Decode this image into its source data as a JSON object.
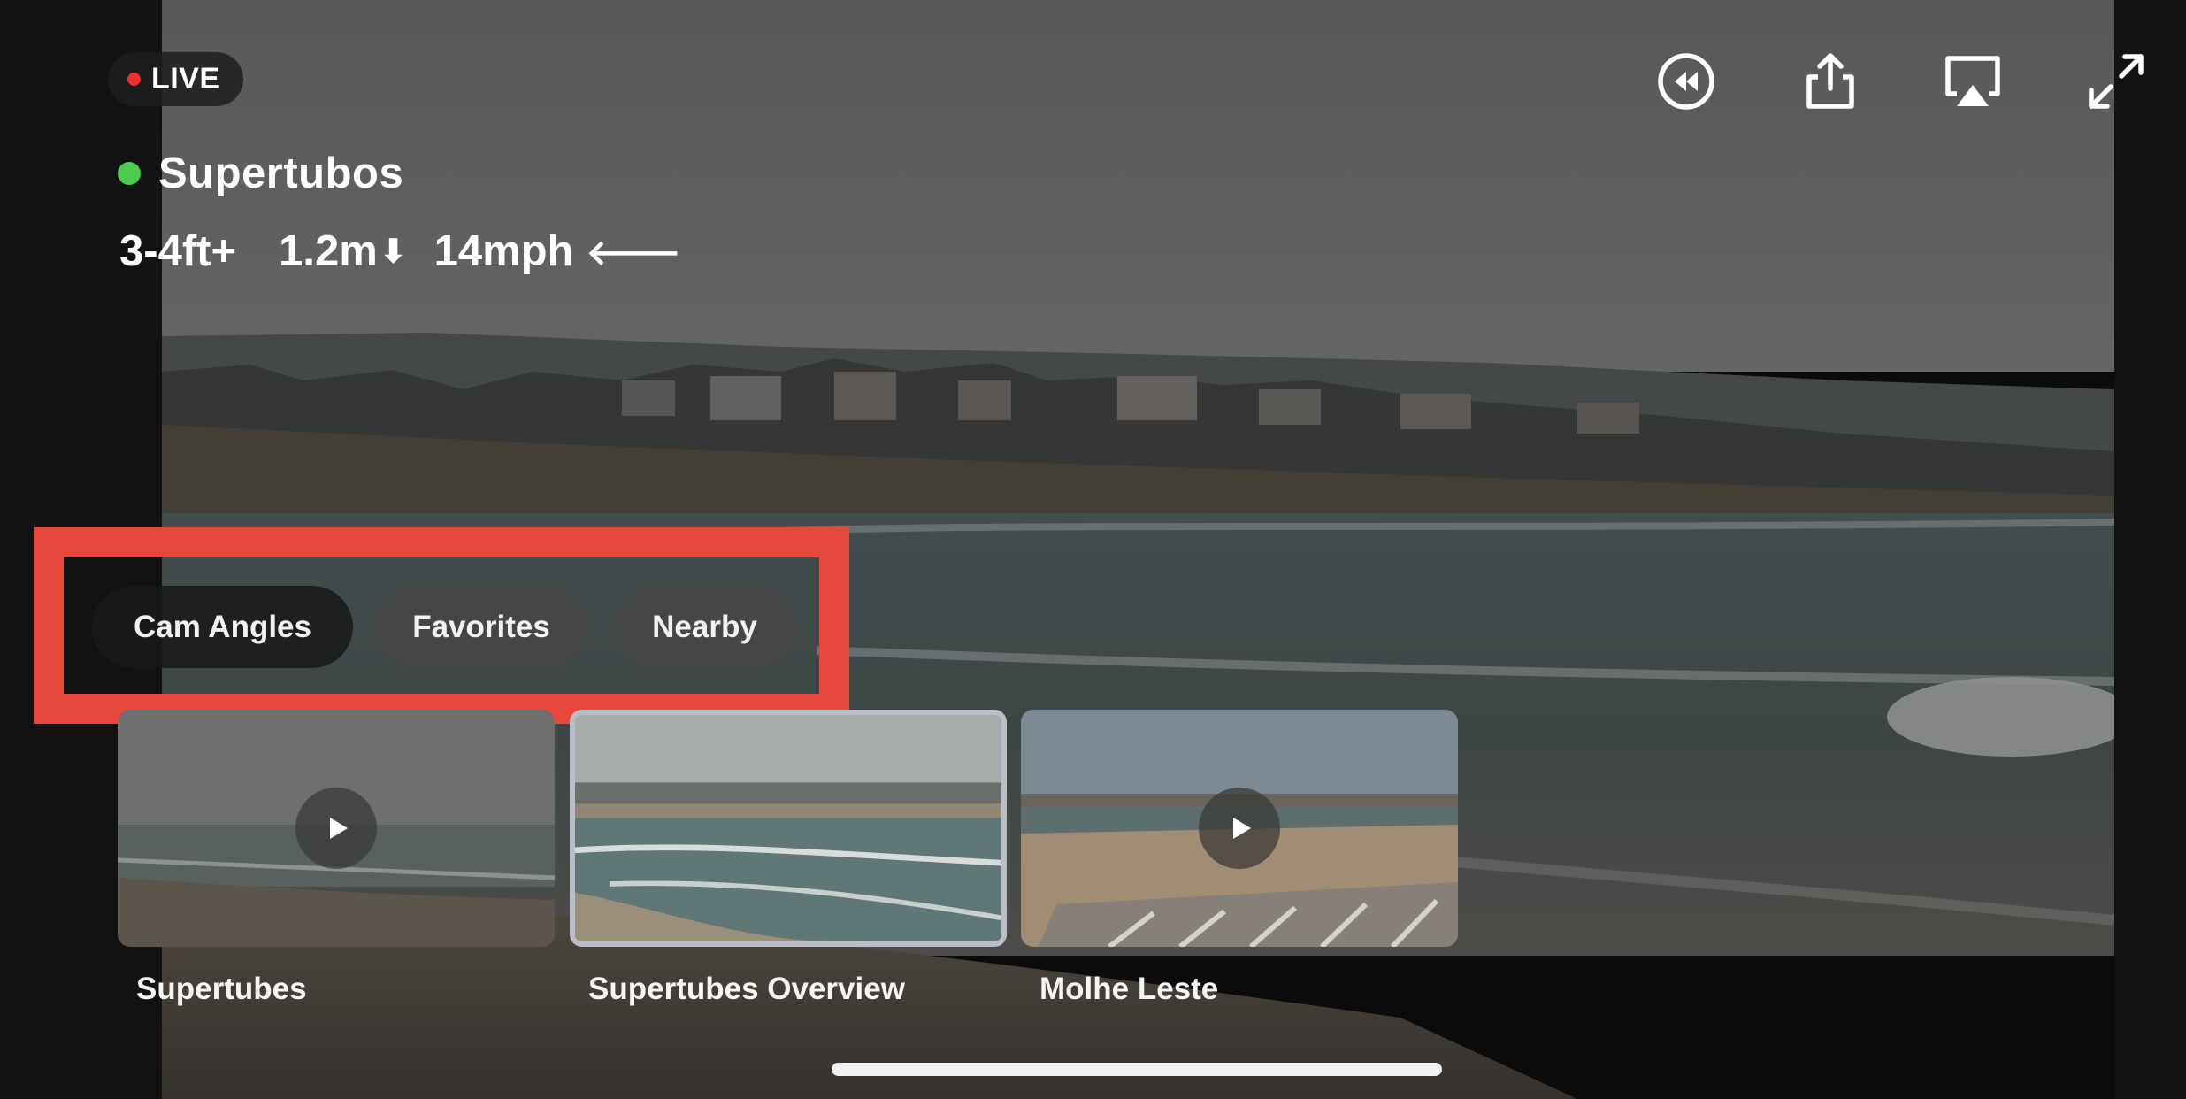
{
  "status": {
    "live_label": "LIVE"
  },
  "spot": {
    "name": "Supertubos",
    "status_color": "#4ccd4f",
    "conditions": {
      "wave_height": "3-4ft+",
      "swell": "1.2m",
      "swell_direction_icon": "arrow-down",
      "wind": "14mph",
      "wind_direction_icon": "arrow-left"
    }
  },
  "controls": {
    "icons": [
      "rewind-icon",
      "share-icon",
      "airplay-icon",
      "expand-icon"
    ]
  },
  "filters": {
    "highlight_color": "#e8473b",
    "chips": [
      {
        "label": "Cam Angles",
        "selected": true
      },
      {
        "label": "Favorites",
        "selected": false
      },
      {
        "label": "Nearby",
        "selected": false
      }
    ]
  },
  "cameras": [
    {
      "label": "Supertubes",
      "selected": false
    },
    {
      "label": "Supertubes Overview",
      "selected": true
    },
    {
      "label": "Molhe Leste",
      "selected": false
    }
  ]
}
